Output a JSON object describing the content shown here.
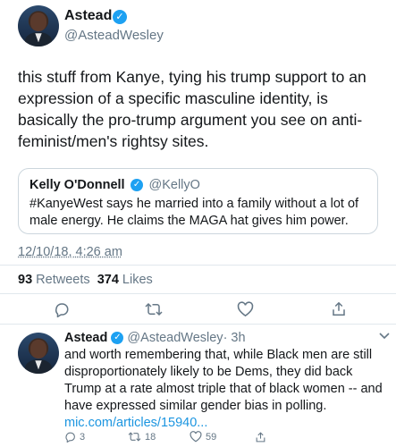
{
  "main_tweet": {
    "name": "Astead",
    "handle": "@AsteadWesley",
    "text": "this stuff from Kanye, tying his trump support to an expression of a specific masculine identity, is basically the pro-trump argument you see on anti-feminist/men's rightsy sites.",
    "timestamp": "12/10/18, 4:26 am"
  },
  "quote_tweet": {
    "name": "Kelly O'Donnell",
    "handle": "@KellyO",
    "text": "#KanyeWest says he married into a family without a lot of male energy.  He claims the MAGA hat gives him power."
  },
  "engagement": {
    "retweets_count": "93",
    "retweets_label": "Retweets",
    "likes_count": "374",
    "likes_label": "Likes"
  },
  "icons": {
    "reply": "reply-icon",
    "retweet": "retweet-icon",
    "like": "heart-icon",
    "share": "share-icon",
    "verified": "verified-icon"
  },
  "reply_tweet": {
    "name": "Astead",
    "handle": "@AsteadWesley",
    "time": "· 3h",
    "text": "and worth remembering that, while Black men are still disproportionately likely to be Dems, they did back Trump at a rate almost triple that of black women -- and have expressed similar gender bias in polling.",
    "link": "mic.com/articles/15940...",
    "reply_count": "3",
    "retweet_count": "18",
    "like_count": "59"
  },
  "colors": {
    "text": "#14171a",
    "secondary": "#657786",
    "accent": "#1da1f2",
    "link": "#1b95e0",
    "divider": "#e1e8ed"
  }
}
